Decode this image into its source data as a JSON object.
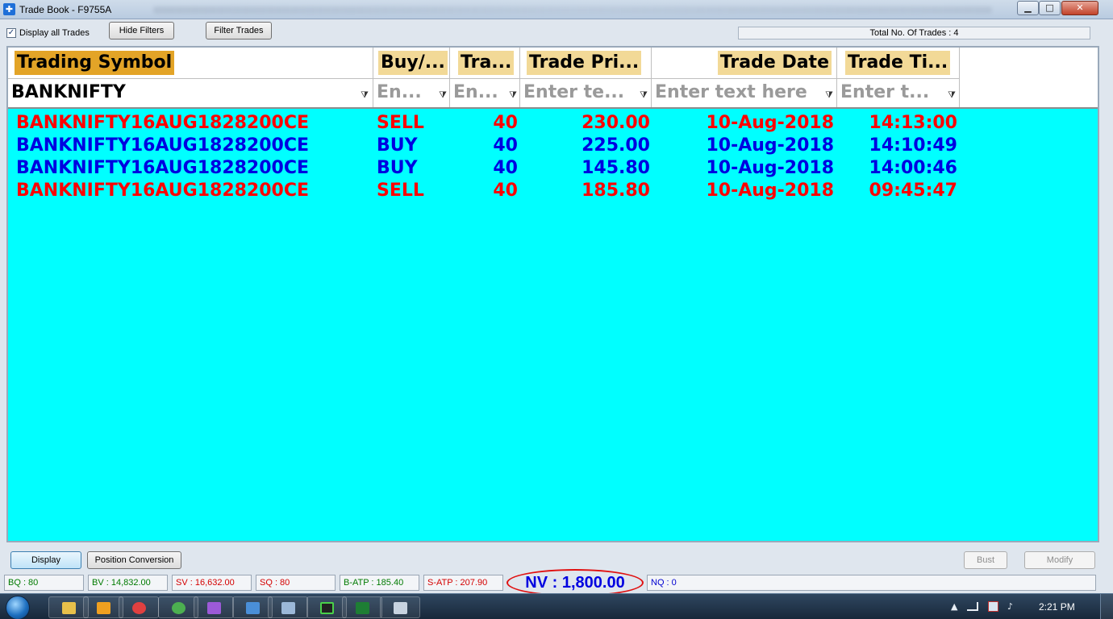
{
  "window": {
    "title": "Trade Book - F9755A",
    "minimize_glyph": "▁",
    "maximize_glyph": "□",
    "close_glyph": "✕",
    "app_icon_glyph": "✚"
  },
  "toolbar": {
    "display_all_checked": true,
    "check_glyph": "✓",
    "display_all_label": "Display all Trades",
    "hide_filters_label": "Hide Filters",
    "filter_trades_label": "Filter Trades",
    "total_trades_text": "Total No. Of Trades : 4"
  },
  "grid": {
    "columns": [
      {
        "label": "Trading Symbol",
        "filter_value": "BANKNIFTY",
        "filter_placeholder": ""
      },
      {
        "label": "Buy/...",
        "filter_value": "",
        "filter_placeholder": "En..."
      },
      {
        "label": "Tra...",
        "filter_value": "",
        "filter_placeholder": "En..."
      },
      {
        "label": "Trade Pri...",
        "filter_value": "",
        "filter_placeholder": "Enter te..."
      },
      {
        "label": "Trade Date",
        "filter_value": "",
        "filter_placeholder": "Enter text here"
      },
      {
        "label": "Trade Ti...",
        "filter_value": "",
        "filter_placeholder": "Enter t..."
      }
    ],
    "funnel_glyph": "⧩",
    "rows": [
      {
        "symbol": "BANKNIFTY16AUG1828200CE",
        "side": "SELL",
        "qty": "40",
        "price": "230.00",
        "date": "10-Aug-2018",
        "time": "14:13:00"
      },
      {
        "symbol": "BANKNIFTY16AUG1828200CE",
        "side": "BUY",
        "qty": "40",
        "price": "225.00",
        "date": "10-Aug-2018",
        "time": "14:10:49"
      },
      {
        "symbol": "BANKNIFTY16AUG1828200CE",
        "side": "BUY",
        "qty": "40",
        "price": "145.80",
        "date": "10-Aug-2018",
        "time": "14:00:46"
      },
      {
        "symbol": "BANKNIFTY16AUG1828200CE",
        "side": "SELL",
        "qty": "40",
        "price": "185.80",
        "date": "10-Aug-2018",
        "time": "09:45:47"
      }
    ],
    "colors": {
      "sell": "#ff0000",
      "buy": "#0000e0",
      "background": "#00ffff"
    }
  },
  "bottom_bar": {
    "display_label": "Display",
    "position_conversion_label": "Position Conversion",
    "bust_label": "Bust",
    "modify_label": "Modify"
  },
  "status": {
    "bq": "BQ : 80",
    "bv": "BV : 14,832.00",
    "sv": "SV : 16,632.00",
    "sq": "SQ : 80",
    "batp": "B-ATP : 185.40",
    "satp": "S-ATP : 207.90",
    "nv": "NV : 1,800.00",
    "nq": "NQ : 0"
  },
  "taskbar": {
    "apps": [
      "file-explorer-icon",
      "media-player-icon",
      "lifebuoy-icon",
      "chrome-icon",
      "triangle-app-icon",
      "remote-desktop-icon",
      "window-app-icon",
      "trading-app-icon",
      "excel-icon",
      "calculator-icon"
    ],
    "clock": "2:21 PM",
    "tray_up_glyph": "▲",
    "tray_volume_glyph": "♪"
  }
}
